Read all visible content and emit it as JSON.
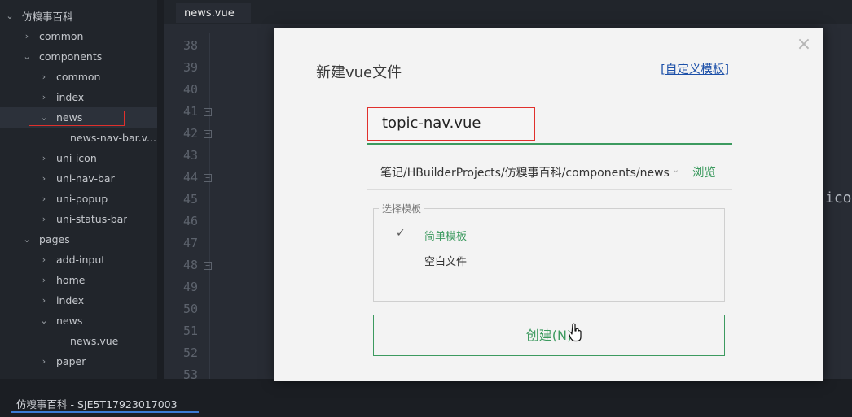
{
  "sidebar": {
    "items": [
      {
        "label": "仿糗事百科",
        "expanded": true,
        "chevron": "chevron-down-icon"
      },
      {
        "label": "common",
        "expanded": false,
        "chevron": "chevron-right-icon"
      },
      {
        "label": "components",
        "expanded": true,
        "chevron": "chevron-down-icon"
      },
      {
        "label": "common",
        "expanded": false,
        "chevron": "chevron-right-icon"
      },
      {
        "label": "index",
        "expanded": false,
        "chevron": "chevron-right-icon"
      },
      {
        "label": "news",
        "expanded": true,
        "chevron": "chevron-down-icon",
        "selected": true
      },
      {
        "label": "news-nav-bar.v...",
        "file": true
      },
      {
        "label": "uni-icon",
        "expanded": false,
        "chevron": "chevron-right-icon"
      },
      {
        "label": "uni-nav-bar",
        "expanded": false,
        "chevron": "chevron-right-icon"
      },
      {
        "label": "uni-popup",
        "expanded": false,
        "chevron": "chevron-right-icon"
      },
      {
        "label": "uni-status-bar",
        "expanded": false,
        "chevron": "chevron-right-icon"
      },
      {
        "label": "pages",
        "expanded": true,
        "chevron": "chevron-down-icon"
      },
      {
        "label": "add-input",
        "expanded": false,
        "chevron": "chevron-right-icon"
      },
      {
        "label": "home",
        "expanded": false,
        "chevron": "chevron-right-icon"
      },
      {
        "label": "index",
        "expanded": false,
        "chevron": "chevron-right-icon"
      },
      {
        "label": "news",
        "expanded": true,
        "chevron": "chevron-down-icon"
      },
      {
        "label": "news.vue",
        "file": true
      },
      {
        "label": "paper",
        "expanded": false,
        "chevron": "chevron-right-icon"
      }
    ]
  },
  "editor": {
    "tab_label": "news.vue",
    "line_numbers": [
      "38",
      "39",
      "40",
      "41",
      "42",
      "43",
      "44",
      "45",
      "46",
      "47",
      "48",
      "49",
      "50",
      "51",
      "52",
      "53"
    ],
    "folded_lines": [
      "41",
      "42",
      "44",
      "48"
    ],
    "code_fragment": "ico"
  },
  "dialog": {
    "title": "新建vue文件",
    "custom_template_link": "[自定义模板]",
    "close_icon": "close-icon",
    "filename_value": "topic-nav.vue",
    "path": "笔记/HBuilderProjects/仿糗事百科/components/news",
    "path_dropdown_icon": "chevron-down-icon",
    "browse_label": "浏览",
    "template_group_label": "选择模板",
    "templates": [
      {
        "label": "简单模板",
        "selected": true
      },
      {
        "label": "空白文件",
        "selected": false
      }
    ],
    "check_glyph": "✓",
    "create_button_label": "创建(N)"
  },
  "statusbar": {
    "project_label": "仿糗事百科 - SJE5T17923017003"
  },
  "colors": {
    "accent_green": "#3c9a5f",
    "highlight_red": "#e0302c",
    "link_blue": "#1b4fa8",
    "status_blue": "#3a7bd5"
  }
}
